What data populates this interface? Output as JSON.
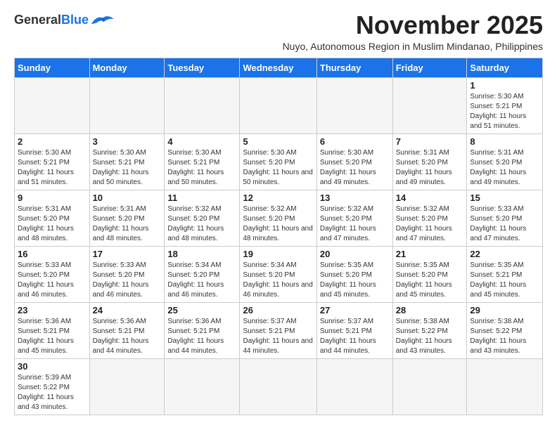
{
  "header": {
    "logo_general": "General",
    "logo_blue": "Blue",
    "month_title": "November 2025",
    "subtitle": "Nuyo, Autonomous Region in Muslim Mindanao, Philippines"
  },
  "weekdays": [
    "Sunday",
    "Monday",
    "Tuesday",
    "Wednesday",
    "Thursday",
    "Friday",
    "Saturday"
  ],
  "weeks": [
    [
      {
        "day": "",
        "info": ""
      },
      {
        "day": "",
        "info": ""
      },
      {
        "day": "",
        "info": ""
      },
      {
        "day": "",
        "info": ""
      },
      {
        "day": "",
        "info": ""
      },
      {
        "day": "",
        "info": ""
      },
      {
        "day": "1",
        "info": "Sunrise: 5:30 AM\nSunset: 5:21 PM\nDaylight: 11 hours\nand 51 minutes."
      }
    ],
    [
      {
        "day": "2",
        "info": "Sunrise: 5:30 AM\nSunset: 5:21 PM\nDaylight: 11 hours\nand 51 minutes."
      },
      {
        "day": "3",
        "info": "Sunrise: 5:30 AM\nSunset: 5:21 PM\nDaylight: 11 hours\nand 50 minutes."
      },
      {
        "day": "4",
        "info": "Sunrise: 5:30 AM\nSunset: 5:21 PM\nDaylight: 11 hours\nand 50 minutes."
      },
      {
        "day": "5",
        "info": "Sunrise: 5:30 AM\nSunset: 5:20 PM\nDaylight: 11 hours\nand 50 minutes."
      },
      {
        "day": "6",
        "info": "Sunrise: 5:30 AM\nSunset: 5:20 PM\nDaylight: 11 hours\nand 49 minutes."
      },
      {
        "day": "7",
        "info": "Sunrise: 5:31 AM\nSunset: 5:20 PM\nDaylight: 11 hours\nand 49 minutes."
      },
      {
        "day": "8",
        "info": "Sunrise: 5:31 AM\nSunset: 5:20 PM\nDaylight: 11 hours\nand 49 minutes."
      }
    ],
    [
      {
        "day": "9",
        "info": "Sunrise: 5:31 AM\nSunset: 5:20 PM\nDaylight: 11 hours\nand 48 minutes."
      },
      {
        "day": "10",
        "info": "Sunrise: 5:31 AM\nSunset: 5:20 PM\nDaylight: 11 hours\nand 48 minutes."
      },
      {
        "day": "11",
        "info": "Sunrise: 5:32 AM\nSunset: 5:20 PM\nDaylight: 11 hours\nand 48 minutes."
      },
      {
        "day": "12",
        "info": "Sunrise: 5:32 AM\nSunset: 5:20 PM\nDaylight: 11 hours\nand 48 minutes."
      },
      {
        "day": "13",
        "info": "Sunrise: 5:32 AM\nSunset: 5:20 PM\nDaylight: 11 hours\nand 47 minutes."
      },
      {
        "day": "14",
        "info": "Sunrise: 5:32 AM\nSunset: 5:20 PM\nDaylight: 11 hours\nand 47 minutes."
      },
      {
        "day": "15",
        "info": "Sunrise: 5:33 AM\nSunset: 5:20 PM\nDaylight: 11 hours\nand 47 minutes."
      }
    ],
    [
      {
        "day": "16",
        "info": "Sunrise: 5:33 AM\nSunset: 5:20 PM\nDaylight: 11 hours\nand 46 minutes."
      },
      {
        "day": "17",
        "info": "Sunrise: 5:33 AM\nSunset: 5:20 PM\nDaylight: 11 hours\nand 46 minutes."
      },
      {
        "day": "18",
        "info": "Sunrise: 5:34 AM\nSunset: 5:20 PM\nDaylight: 11 hours\nand 46 minutes."
      },
      {
        "day": "19",
        "info": "Sunrise: 5:34 AM\nSunset: 5:20 PM\nDaylight: 11 hours\nand 46 minutes."
      },
      {
        "day": "20",
        "info": "Sunrise: 5:35 AM\nSunset: 5:20 PM\nDaylight: 11 hours\nand 45 minutes."
      },
      {
        "day": "21",
        "info": "Sunrise: 5:35 AM\nSunset: 5:20 PM\nDaylight: 11 hours\nand 45 minutes."
      },
      {
        "day": "22",
        "info": "Sunrise: 5:35 AM\nSunset: 5:21 PM\nDaylight: 11 hours\nand 45 minutes."
      }
    ],
    [
      {
        "day": "23",
        "info": "Sunrise: 5:36 AM\nSunset: 5:21 PM\nDaylight: 11 hours\nand 45 minutes."
      },
      {
        "day": "24",
        "info": "Sunrise: 5:36 AM\nSunset: 5:21 PM\nDaylight: 11 hours\nand 44 minutes."
      },
      {
        "day": "25",
        "info": "Sunrise: 5:36 AM\nSunset: 5:21 PM\nDaylight: 11 hours\nand 44 minutes."
      },
      {
        "day": "26",
        "info": "Sunrise: 5:37 AM\nSunset: 5:21 PM\nDaylight: 11 hours\nand 44 minutes."
      },
      {
        "day": "27",
        "info": "Sunrise: 5:37 AM\nSunset: 5:21 PM\nDaylight: 11 hours\nand 44 minutes."
      },
      {
        "day": "28",
        "info": "Sunrise: 5:38 AM\nSunset: 5:22 PM\nDaylight: 11 hours\nand 43 minutes."
      },
      {
        "day": "29",
        "info": "Sunrise: 5:38 AM\nSunset: 5:22 PM\nDaylight: 11 hours\nand 43 minutes."
      }
    ],
    [
      {
        "day": "30",
        "info": "Sunrise: 5:39 AM\nSunset: 5:22 PM\nDaylight: 11 hours\nand 43 minutes."
      },
      {
        "day": "",
        "info": ""
      },
      {
        "day": "",
        "info": ""
      },
      {
        "day": "",
        "info": ""
      },
      {
        "day": "",
        "info": ""
      },
      {
        "day": "",
        "info": ""
      },
      {
        "day": "",
        "info": ""
      }
    ]
  ]
}
